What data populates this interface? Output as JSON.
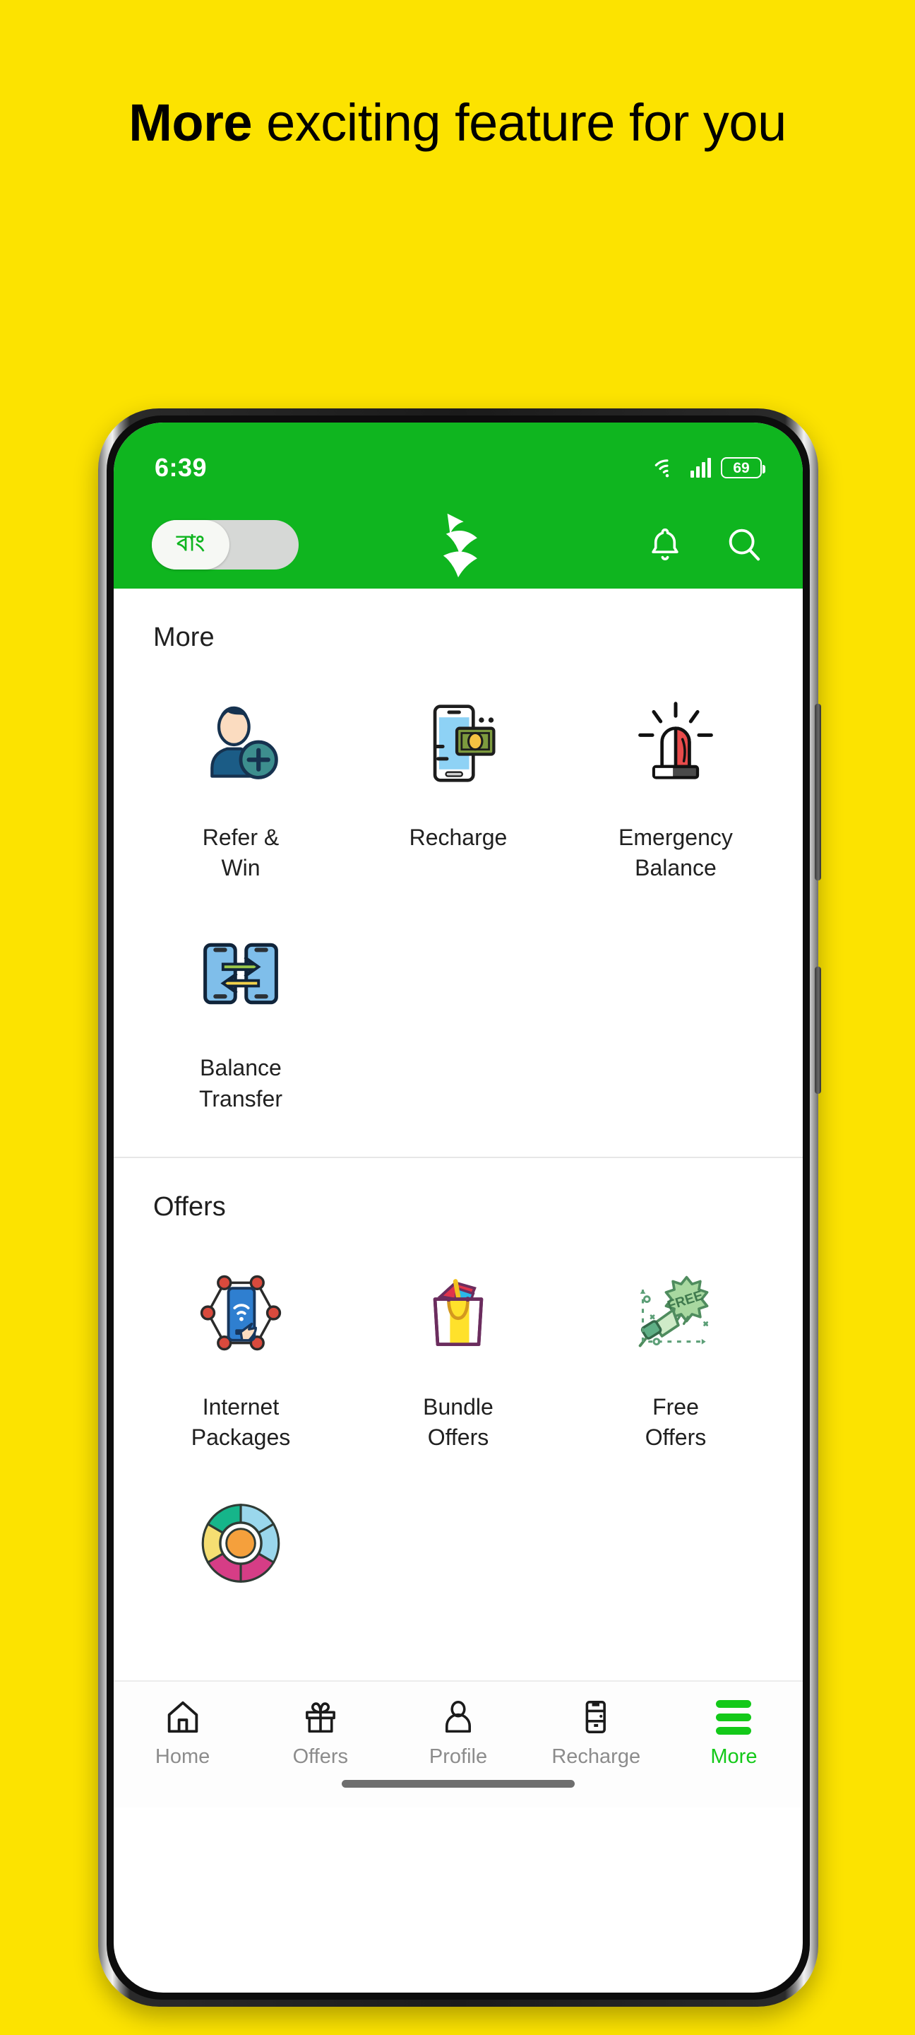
{
  "promo": {
    "headline_bold": "More",
    "headline_rest": " exciting feature for you",
    "bg_color": "#FCE300"
  },
  "phone": {
    "statusbar": {
      "time": "6:39",
      "battery_percent": "69",
      "icons": [
        "wifi-icon",
        "signal-bars-icon",
        "battery-icon"
      ]
    },
    "appbar": {
      "language_toggle_label": "বাং",
      "logo_name": "brand-swoosh-logo",
      "bell_icon": "bell-icon",
      "search_icon": "search-icon",
      "bar_color": "#0FB51F"
    },
    "sections": [
      {
        "title": "More",
        "tiles": [
          {
            "label": "Refer &\nWin",
            "icon": "refer-win-icon"
          },
          {
            "label": "Recharge",
            "icon": "recharge-icon"
          },
          {
            "label": "Emergency\nBalance",
            "icon": "emergency-balance-icon"
          },
          {
            "label": "Balance\nTransfer",
            "icon": "balance-transfer-icon"
          }
        ]
      },
      {
        "title": "Offers",
        "tiles": [
          {
            "label": "Internet\nPackages",
            "icon": "internet-packages-icon"
          },
          {
            "label": "Bundle\nOffers",
            "icon": "bundle-offers-icon"
          },
          {
            "label": "Free\nOffers",
            "icon": "free-offers-icon"
          },
          {
            "label": "",
            "icon": "color-wheel-icon"
          }
        ]
      }
    ],
    "bottom_nav": {
      "active": "More",
      "active_color": "#13C919",
      "inactive_color": "#8C8C8C",
      "items": [
        {
          "label": "Home",
          "icon": "home-icon"
        },
        {
          "label": "Offers",
          "icon": "gift-icon"
        },
        {
          "label": "Profile",
          "icon": "person-icon"
        },
        {
          "label": "Recharge",
          "icon": "recharge-card-icon"
        },
        {
          "label": "More",
          "icon": "hamburger-icon"
        }
      ]
    }
  }
}
